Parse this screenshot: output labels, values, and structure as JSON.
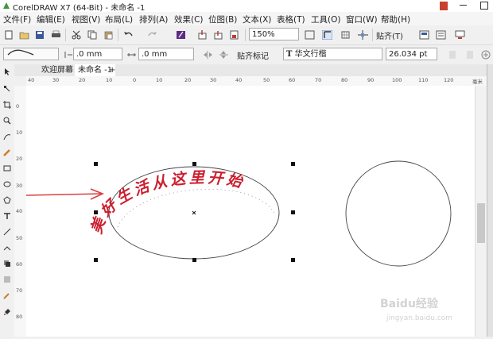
{
  "window": {
    "title": "CorelDRAW X7 (64-Bit) - 未命名 -1"
  },
  "menu": [
    "文件(F)",
    "编辑(E)",
    "视图(V)",
    "布局(L)",
    "排列(A)",
    "效果(C)",
    "位图(B)",
    "文本(X)",
    "表格(T)",
    "工具(O)",
    "窗口(W)",
    "帮助(H)"
  ],
  "toolbar1": {
    "zoom": "150%",
    "snap_label": "贴齐(T)"
  },
  "toolbar2": {
    "width_value": ".0 mm",
    "height_value": ".0 mm",
    "snap_marks_label": "贴齐标记",
    "font_icon": "T",
    "font_name": "华文行楷",
    "font_size": "26.034 pt"
  },
  "tabs": {
    "welcome": "欢迎屏幕",
    "doc": "未命名 -1",
    "add": "+"
  },
  "ruler": {
    "h": [
      [
        "40",
        35
      ],
      [
        "30",
        66
      ],
      [
        "20",
        99
      ],
      [
        "10",
        133
      ],
      [
        "0",
        167
      ],
      [
        "10",
        196
      ],
      [
        "20",
        232
      ],
      [
        "30",
        264
      ],
      [
        "40",
        296
      ],
      [
        "50",
        331
      ],
      [
        "60",
        363
      ],
      [
        "70",
        396
      ],
      [
        "80",
        429
      ],
      [
        "90",
        462
      ],
      [
        "100",
        493
      ],
      [
        "110",
        526
      ],
      [
        "120",
        558
      ]
    ],
    "v": [
      [
        "0",
        130
      ],
      [
        "10",
        163
      ],
      [
        "20",
        196
      ],
      [
        "30",
        230
      ],
      [
        "40",
        262
      ],
      [
        "50",
        296
      ],
      [
        "60",
        329
      ],
      [
        "70",
        362
      ],
      [
        "80",
        395
      ]
    ],
    "unit": "毫米"
  },
  "canvas": {
    "arc_text": "美好生活从这里开始",
    "arrow_color": "#d94040",
    "text_color": "#cc1f2f"
  },
  "watermark": {
    "brand": "Baidu经验",
    "url": "jingyan.baidu.com"
  }
}
